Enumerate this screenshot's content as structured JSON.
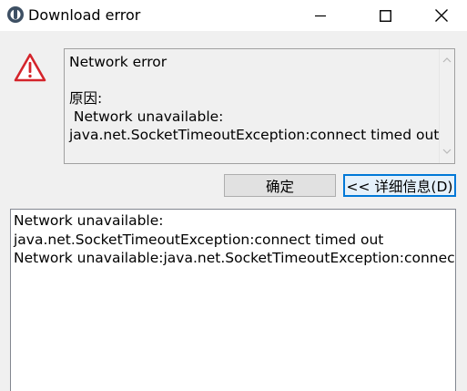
{
  "window": {
    "title": "Download error",
    "app_icon": "app-logo-icon",
    "controls": [
      "minimize-icon",
      "maximize-icon",
      "close-icon"
    ]
  },
  "message": {
    "icon": "warning-icon",
    "lines": [
      "Network error",
      "",
      "原因:",
      " Network unavailable:",
      "java.net.SocketTimeoutException:connect timed out"
    ]
  },
  "buttons": {
    "ok_label": "确定",
    "details_label": "<< 详细信息(D)"
  },
  "details": {
    "lines": [
      "Network unavailable:",
      "java.net.SocketTimeoutException:connect timed out",
      "Network unavailable:java.net.SocketTimeoutException:connect timed out"
    ]
  },
  "colors": {
    "warning_red": "#d4242b",
    "focus_blue": "#0078d7"
  }
}
